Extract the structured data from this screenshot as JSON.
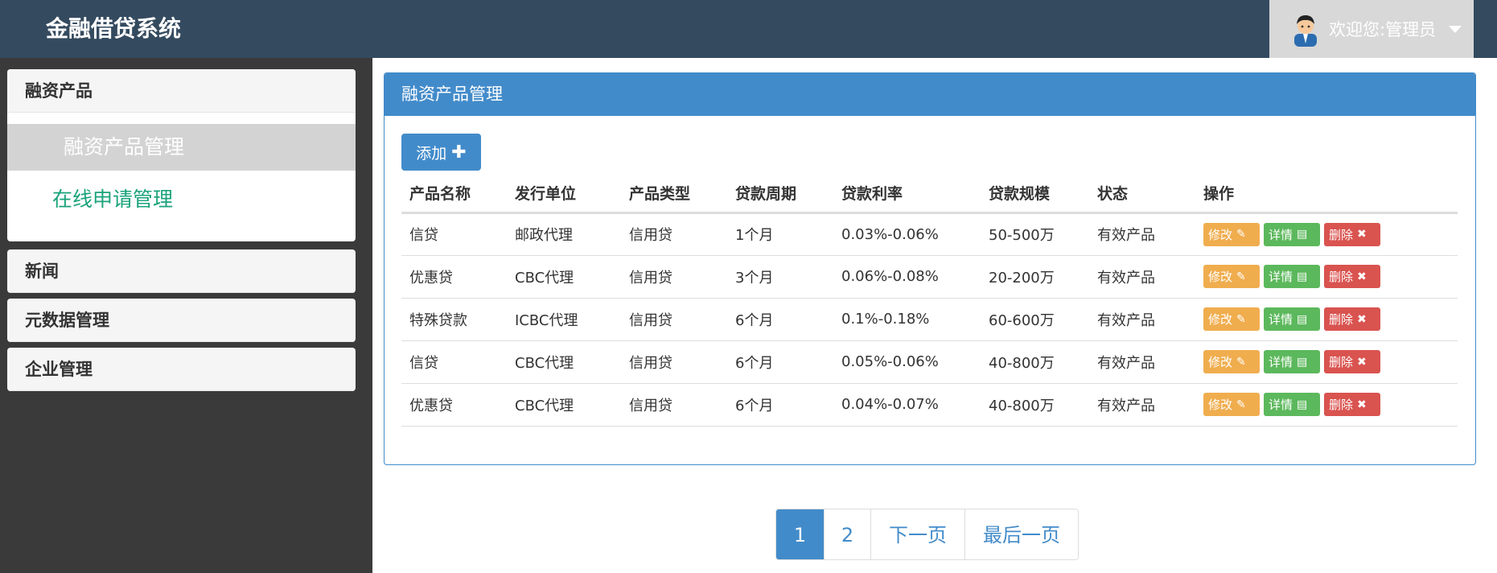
{
  "header": {
    "brand": "金融借贷系统",
    "welcome": "欢迎您:管理员"
  },
  "sidebar": {
    "groups": [
      {
        "label": "融资产品",
        "items": [
          {
            "label": "融资产品管理",
            "active": true
          },
          {
            "label": "在线申请管理",
            "active": false
          }
        ]
      },
      {
        "label": "新闻"
      },
      {
        "label": "元数据管理"
      },
      {
        "label": "企业管理"
      }
    ]
  },
  "main": {
    "card_title": "融资产品管理",
    "add_label": "添加",
    "columns": [
      "产品名称",
      "发行单位",
      "产品类型",
      "贷款周期",
      "贷款利率",
      "贷款规模",
      "状态",
      "操作"
    ],
    "rows": [
      [
        "信贷",
        "邮政代理",
        "信用贷",
        "1个月",
        "0.03%-0.06%",
        "50-500万",
        "有效产品"
      ],
      [
        "优惠贷",
        "CBC代理",
        "信用贷",
        "3个月",
        "0.06%-0.08%",
        "20-200万",
        "有效产品"
      ],
      [
        "特殊贷款",
        "ICBC代理",
        "信用贷",
        "6个月",
        "0.1%-0.18%",
        "60-600万",
        "有效产品"
      ],
      [
        "信贷",
        "CBC代理",
        "信用贷",
        "6个月",
        "0.05%-0.06%",
        "40-800万",
        "有效产品"
      ],
      [
        "优惠贷",
        "CBC代理",
        "信用贷",
        "6个月",
        "0.04%-0.07%",
        "40-800万",
        "有效产品"
      ]
    ],
    "ops": {
      "edit": "修改",
      "detail": "详情",
      "delete": "删除"
    }
  },
  "pagination": {
    "pages": [
      "1",
      "2"
    ],
    "current": "1",
    "next": "下一页",
    "last": "最后一页"
  },
  "colors": {
    "topbar": "#344a5f",
    "primary": "#428bca",
    "edit": "#f0ad4e",
    "detail": "#5cb85c",
    "delete": "#d9534f",
    "link_green": "#1aa37a"
  }
}
